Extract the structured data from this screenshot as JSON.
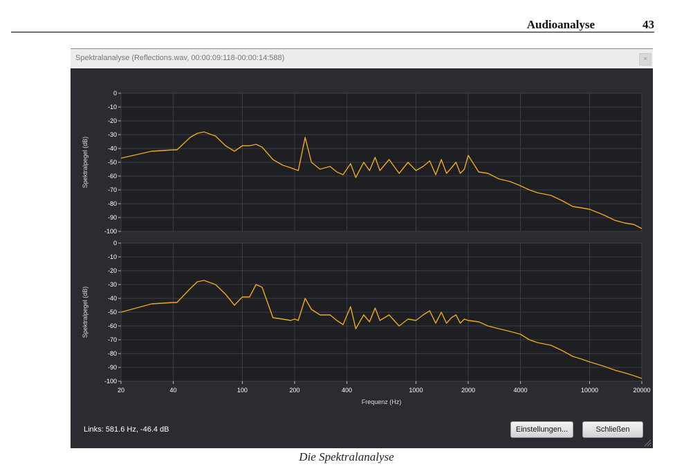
{
  "page": {
    "header_title": "Audioanalyse",
    "page_number": "43",
    "caption": "Die Spektralanalyse"
  },
  "window": {
    "title": "Spektralanalyse (Reflections.wav, 00:00:09:118-00:00:14:588)",
    "close_label": "×",
    "status": "Links: 581.6 Hz, -46.4 dB",
    "buttons": {
      "settings": "Einstellungen...",
      "close": "Schließen"
    }
  },
  "colors": {
    "background": "#2a2c31",
    "plot_bg": "#1e1f23",
    "grid": "#3d3f45",
    "trace": "#f0a81e",
    "text": "#ffffff"
  },
  "chart_data": [
    {
      "type": "line",
      "channel": "left",
      "ylabel": "Spektralpegel (dB)",
      "xlabel": "",
      "xscale": "log",
      "xlim": [
        20,
        20000
      ],
      "ylim": [
        -100,
        0
      ],
      "yticks": [
        0,
        -10,
        -20,
        -30,
        -40,
        -50,
        -60,
        -70,
        -80,
        -90,
        -100
      ],
      "xticks": [],
      "grid": true,
      "series": [
        {
          "x": [
            20,
            30,
            40,
            42,
            50,
            55,
            60,
            70,
            80,
            90,
            100,
            110,
            120,
            130,
            150,
            170,
            190,
            200,
            210,
            230,
            250,
            280,
            320,
            350,
            380,
            420,
            450,
            500,
            540,
            581.6,
            620,
            700,
            800,
            900,
            1000,
            1100,
            1200,
            1300,
            1400,
            1500,
            1600,
            1700,
            1800,
            1900,
            2000,
            2300,
            2600,
            3000,
            3500,
            4000,
            4500,
            5000,
            6000,
            7000,
            8000,
            9000,
            10000,
            12000,
            14000,
            16000,
            18000,
            20000
          ],
          "y": [
            -47,
            -42,
            -41,
            -41,
            -32,
            -29,
            -28,
            -31,
            -38,
            -42,
            -38,
            -38,
            -37,
            -39,
            -48,
            -52,
            -54,
            -55,
            -56,
            -32,
            -50,
            -55,
            -53,
            -57,
            -59,
            -51,
            -61,
            -50,
            -56,
            -46.4,
            -56,
            -48,
            -58,
            -50,
            -56,
            -53,
            -49,
            -59,
            -48,
            -58,
            -54,
            -50,
            -58,
            -55,
            -45,
            -57,
            -58,
            -62,
            -64,
            -67,
            -70,
            -72,
            -74,
            -78,
            -82,
            -83,
            -84,
            -88,
            -92,
            -94,
            -95,
            -98
          ]
        }
      ]
    },
    {
      "type": "line",
      "channel": "right",
      "ylabel": "Spektralpegel (dB)",
      "xlabel": "Frequenz (Hz)",
      "xscale": "log",
      "xlim": [
        20,
        20000
      ],
      "ylim": [
        -100,
        0
      ],
      "yticks": [
        0,
        -10,
        -20,
        -30,
        -40,
        -50,
        -60,
        -70,
        -80,
        -90,
        -100
      ],
      "xticks": [
        20,
        40,
        100,
        200,
        400,
        1000,
        2000,
        4000,
        10000,
        20000
      ],
      "xtick_labels": [
        "20",
        "40",
        "100",
        "200",
        "400",
        "1000",
        "2000",
        "4000",
        "10000",
        "20000"
      ],
      "grid": true,
      "series": [
        {
          "x": [
            20,
            30,
            40,
            42,
            50,
            55,
            60,
            70,
            80,
            90,
            100,
            110,
            120,
            130,
            150,
            170,
            190,
            200,
            210,
            230,
            250,
            280,
            320,
            350,
            380,
            420,
            450,
            500,
            540,
            581.6,
            620,
            700,
            800,
            900,
            1000,
            1100,
            1200,
            1300,
            1400,
            1500,
            1600,
            1700,
            1800,
            1900,
            2000,
            2300,
            2600,
            3000,
            3500,
            4000,
            4500,
            5000,
            6000,
            7000,
            8000,
            9000,
            10000,
            12000,
            14000,
            16000,
            18000,
            20000
          ],
          "y": [
            -50,
            -44,
            -43,
            -43,
            -33,
            -28,
            -27,
            -30,
            -37,
            -45,
            -39,
            -39,
            -30,
            -32,
            -54,
            -55,
            -56,
            -55,
            -56,
            -40,
            -48,
            -52,
            -52,
            -56,
            -59,
            -46,
            -62,
            -52,
            -57,
            -47,
            -56,
            -52,
            -60,
            -55,
            -56,
            -52,
            -49,
            -58,
            -50,
            -58,
            -54,
            -52,
            -58,
            -55,
            -56,
            -57,
            -60,
            -62,
            -64,
            -66,
            -70,
            -72,
            -74,
            -78,
            -82,
            -84,
            -86,
            -89,
            -92,
            -94,
            -96,
            -98
          ]
        }
      ]
    }
  ]
}
